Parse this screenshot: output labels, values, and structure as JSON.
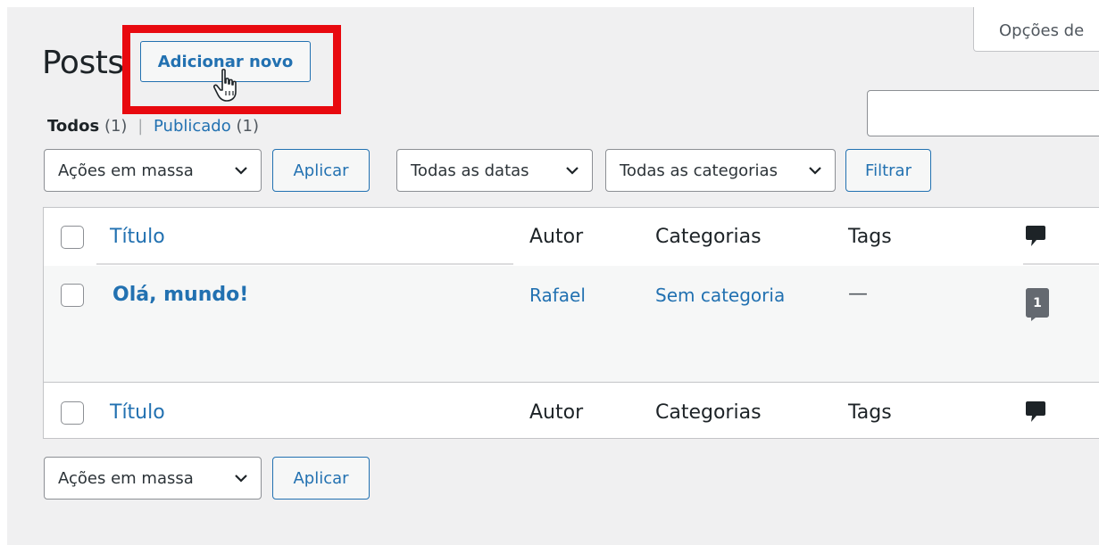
{
  "header": {
    "page_title": "Posts",
    "add_new_label": "Adicionar novo",
    "screen_options_label": "Opções de"
  },
  "search": {
    "value": "",
    "placeholder": ""
  },
  "filters": {
    "all_label": "Todos",
    "all_count": "(1)",
    "published_label": "Publicado",
    "published_count": "(1)"
  },
  "top_nav": {
    "bulk_actions": "Ações em massa",
    "apply": "Aplicar",
    "all_dates": "Todas as datas",
    "all_categories": "Todas as categorias",
    "filter": "Filtrar"
  },
  "table": {
    "columns": {
      "title": "Título",
      "author": "Autor",
      "categories": "Categorias",
      "tags": "Tags"
    },
    "rows": [
      {
        "title": "Olá, mundo!",
        "author": "Rafael",
        "categories": "Sem categoria",
        "tags": "—",
        "comments": "1"
      }
    ]
  },
  "bottom_nav": {
    "bulk_actions": "Ações em massa",
    "apply": "Aplicar"
  },
  "colors": {
    "accent": "#2271b1",
    "highlight": "#e8090f",
    "background": "#f0f0f1"
  }
}
